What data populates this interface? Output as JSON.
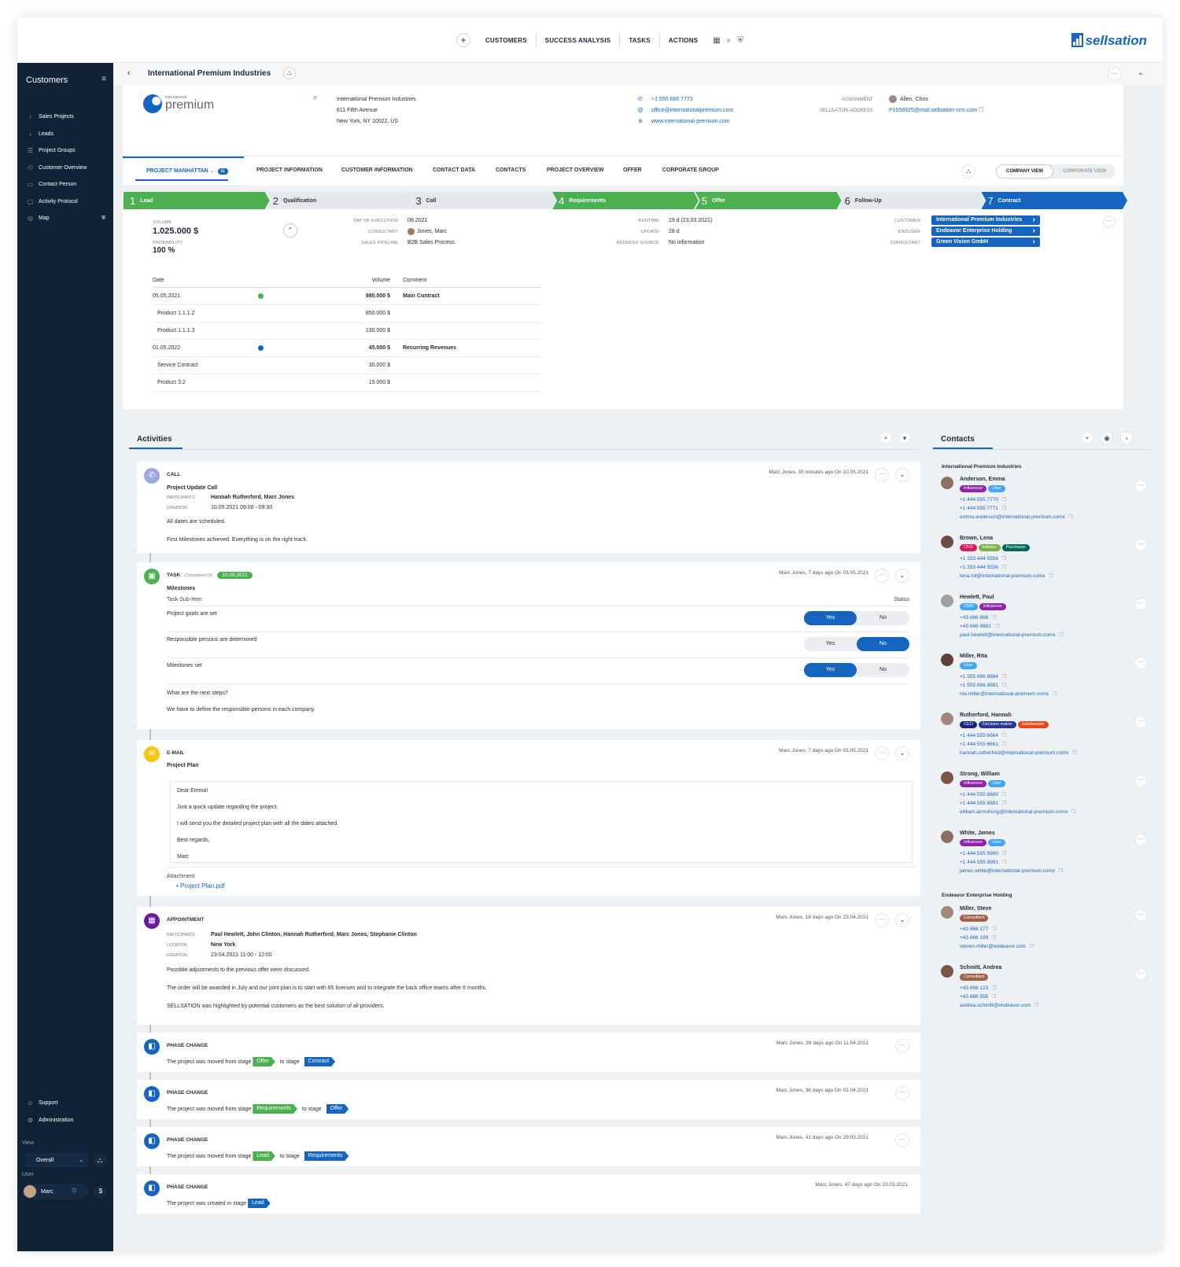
{
  "topnav": {
    "plus": "+",
    "items": [
      "CUSTOMERS",
      "SUCCESS ANALYSIS",
      "TASKS",
      "ACTIONS"
    ],
    "brand": "sellsation"
  },
  "sidebar": {
    "title": "Customers",
    "items": [
      "Sales Projects",
      "Leads",
      "Project Groups",
      "Customer Overview",
      "Contact Person",
      "Activity Protocol",
      "Map"
    ],
    "bottom_items": [
      "Support",
      "Administration"
    ],
    "view_label": "View",
    "view_value": "Overall",
    "user_label": "User",
    "user_name": "Marc",
    "currency": "$"
  },
  "header": {
    "title": "International Premium Industries"
  },
  "company": {
    "logo_small": "international",
    "logo_big": "premium",
    "address": [
      "International Premium Industries",
      "611 Fifth Avenue",
      "New York, NY 10022, US"
    ],
    "phone": "+1 555 666 7773",
    "email": "office@internationalpremium.com",
    "web": "www.international-premium.com",
    "assignment_label": "ASSIGNMENT",
    "assignment_value": "Allen, Chris",
    "address_label": "SELLSATION-ADDRESS",
    "address_value": "P1058925@mail.sellsation-crm.com"
  },
  "tabs": {
    "active": "PROJECT MANHATTAN",
    "badge": "11",
    "items": [
      "PROJECT INFORMATION",
      "CUSTOMER INFORMATION",
      "CONTACT DATA",
      "CONTACTS",
      "PROJECT OVERVIEW",
      "OFFER",
      "CORPORATE GROUP"
    ],
    "company_view": "COMPANY VIEW",
    "corporate_view": "CORPORATE VIEW"
  },
  "stages": [
    {
      "n": "1",
      "label": "Lead",
      "state": "done"
    },
    {
      "n": "2",
      "label": "Qualification",
      "state": "todo"
    },
    {
      "n": "3",
      "label": "Call",
      "state": "todo"
    },
    {
      "n": "4",
      "label": "Requirements",
      "state": "done"
    },
    {
      "n": "5",
      "label": "Offer",
      "state": "done"
    },
    {
      "n": "6",
      "label": "Follow-Up",
      "state": "todo"
    },
    {
      "n": "7",
      "label": "Contract",
      "state": "current"
    }
  ],
  "details": {
    "volume_label": "VOLUME",
    "volume": "1.025.000 $",
    "probability_label": "PROBABILITY",
    "probability": "100 %",
    "keys1": [
      "DAY OF EXECUTION",
      "CONSULTANT",
      "SALES PIPELINE"
    ],
    "vals1": [
      "08.2021",
      "Jones, Marc",
      "B2B Sales Process"
    ],
    "keys2": [
      "RUNTIME",
      "UPDATE",
      "ADDRESS SOURCE"
    ],
    "vals2": [
      "19 d (23.03.2021)",
      "28 d",
      "No information"
    ],
    "keys3": [
      "CUSTOMER",
      "ENDUSER",
      "CONSULTANT"
    ],
    "vals3": [
      "International Premium Industries",
      "Endeavor Enterprise Holding",
      "Green Vision GmbH"
    ]
  },
  "volume_table": {
    "headers": [
      "Date",
      "Volume",
      "Comment"
    ],
    "rows": [
      {
        "date": "05.05.2021",
        "volume": "980.000 $",
        "comment": "Main Contract",
        "dot": "#4caf50"
      },
      {
        "date": "Product 1.1.1.2",
        "volume": "850.000 $",
        "comment": "",
        "sub": true
      },
      {
        "date": "Product 1.1.1.3",
        "volume": "130.000 $",
        "comment": "",
        "sub": true
      },
      {
        "date": "01.05.2022",
        "volume": "45.000 $",
        "comment": "Recurring Revenues",
        "dot": "#1565c0"
      },
      {
        "date": "Service Contract",
        "volume": "30.000 $",
        "comment": "",
        "sub": true
      },
      {
        "date": "Product 3.2",
        "volume": "15.000 $",
        "comment": "",
        "sub": true
      }
    ]
  },
  "activities": {
    "title": "Activities",
    "call": {
      "type": "CALL",
      "meta": "Marc Jones, 35 minutes ago On 10.05.2021",
      "title": "Project Update Call",
      "participants_label": "PARTICIPANTS:",
      "participants": "Hannah Rutherford, Marc Jones",
      "duration_label": "DURATION:",
      "duration": "10.05.2021 09:00 - 09:30",
      "text1": "All dates are scheduled.",
      "text2": "First Milestones achieved. Everything is on the right track."
    },
    "task": {
      "type": "TASK",
      "completed_label": "Completed On",
      "completed_date": "10.05.2021",
      "meta": "Marc Jones, 7 days ago On 03.05.2021",
      "title": "Milestones",
      "sub_header": "Task Sub-Item",
      "status_header": "Status",
      "items": [
        "Project goals are set",
        "Responsible persons are determined",
        "Milestones set"
      ],
      "yes": "Yes",
      "no": "No",
      "question": "What are the next steps?",
      "answer": "We have to define the responsible persons in each company."
    },
    "email": {
      "type": "E-MAIL",
      "meta": "Marc Jones, 7 days ago On 03.05.2021",
      "title": "Project Plan",
      "lines": [
        "Dear Emma!",
        "Just a quick update regarding the project.",
        "I will send you the detailed project plan with all the dates attached.",
        "Best regards,",
        "Marc"
      ],
      "attachment_label": "Attachment",
      "attachment": "Project Plan.pdf"
    },
    "appointment": {
      "type": "APPOINTMENT",
      "meta": "Marc Jones, 16 days ago On 23.04.2021",
      "participants_label": "PARTICIPANTS:",
      "participants": "Paul Hewlett, John Clinton, Hannah Rutherford, Marc Jones, Stephanie Clinton",
      "location_label": "LOCATION:",
      "location": "New York",
      "duration_label": "DURATION:",
      "duration": "23.04.2021 11:00 - 12:00",
      "text1": "Possible adjustments to the previous offer were discussed.",
      "text2": "The order will be awarded in July and our joint plan is to start with 65 licenses and to integrate the back office teams after 6 months.",
      "text3": "SELLSATION was highlighted by potential customers as the best solution of all providers."
    },
    "phases": [
      {
        "type": "PHASE CHANGE",
        "meta": "Marc Jones, 28 days ago On 11.04.2021",
        "text": "The project was moved from stage",
        "from": "Offer",
        "to_text": "to stage",
        "to": "Contract"
      },
      {
        "type": "PHASE CHANGE",
        "meta": "Marc Jones, 36 days ago On 03.04.2021",
        "text": "The project was moved from stage",
        "from": "Requirements",
        "to_text": "to stage",
        "to": "Offer"
      },
      {
        "type": "PHASE CHANGE",
        "meta": "Marc Jones, 41 days ago On 29.03.2021",
        "text": "The project was moved from stage",
        "from": "Lead",
        "to_text": "to stage",
        "to": "Requirements"
      },
      {
        "type": "PHASE CHANGE",
        "meta": "Marc Jones, 47 days ago On 23.03.2021",
        "text": "The project was created in stage",
        "from": "",
        "to_text": "",
        "to": "Lead"
      }
    ]
  },
  "contacts": {
    "title": "Contacts",
    "group1": "International Premium Industries",
    "group2": "Endeavor Enterprise Holding",
    "people": [
      {
        "name": "Anderson, Emma",
        "badges": [
          [
            "Influencer",
            "#8e24aa"
          ],
          [
            "User",
            "#42a5f5"
          ]
        ],
        "p1": "+1 444 555 7770",
        "p2": "+1 444 555 7771",
        "mail": "emma.anderson@international-premium.comx"
      },
      {
        "name": "Brown, Lena",
        "badges": [
          [
            "CFO",
            "#d81b60"
          ],
          [
            "Initiator",
            "#7cb342"
          ],
          [
            "Purchaser",
            "#00695c"
          ]
        ],
        "p1": "+1 333 444 5556",
        "p2": "+1 333 444 5556",
        "mail": "lena.rot@international-premium.comx"
      },
      {
        "name": "Hewlett, Paul",
        "badges": [
          [
            "CMO",
            "#42a5f5"
          ],
          [
            "Influencer",
            "#8e24aa"
          ]
        ],
        "p1": "+43 666 888",
        "p2": "+43 666 8881",
        "mail": "paul.hewlett@international-premium.comx"
      },
      {
        "name": "Miller, Rita",
        "badges": [
          [
            "User",
            "#42a5f5"
          ]
        ],
        "p1": "+1 555 666 8884",
        "p2": "+1 555 666 8881",
        "mail": "rita.miller@international-premium.comx"
      },
      {
        "name": "Rutherford, Hannah",
        "badges": [
          [
            "CEO",
            "#1a237e"
          ],
          [
            "Decision maker",
            "#283593"
          ],
          [
            "Gatekeeper",
            "#e64a19"
          ]
        ],
        "p1": "+1 444 555 6664",
        "p2": "+1 444 555 6661",
        "mail": "hannah.rutherford@international-premium.comx"
      },
      {
        "name": "Strong, William",
        "badges": [
          [
            "Influencer",
            "#8e24aa"
          ],
          [
            "User",
            "#42a5f5"
          ]
        ],
        "p1": "+1 444 555 8889",
        "p2": "+1 444 555 8881",
        "mail": "william.armstrong@international-premium.comx"
      },
      {
        "name": "White, James",
        "badges": [
          [
            "Influencer",
            "#8e24aa"
          ],
          [
            "User",
            "#42a5f5"
          ]
        ],
        "p1": "+1 444 555 9990",
        "p2": "+1 444 555 9991",
        "mail": "james.white@international-premium.comx"
      },
      {
        "name": "Miller, Steve",
        "badges": [
          [
            "Consultant",
            "#a1604a"
          ]
        ],
        "p1": "+43 866 177",
        "p2": "+43 866 199",
        "mail": "steven.miller@endeavor.com"
      },
      {
        "name": "Schmitt, Andrea",
        "badges": [
          [
            "Consultant",
            "#a1604a"
          ]
        ],
        "p1": "+43 866 123",
        "p2": "+43 866 555",
        "mail": "andrea.schmitt@endeavor.com"
      }
    ]
  },
  "colors": {
    "brand": "#1565c0",
    "sidebar": "#0f2236",
    "green": "#4caf50"
  }
}
